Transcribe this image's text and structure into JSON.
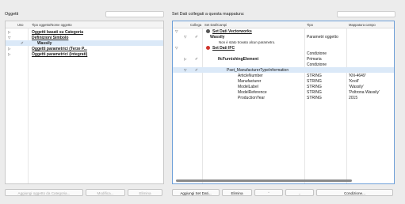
{
  "left": {
    "title": "Oggetti",
    "columns": {
      "use": "Uso",
      "type": "Tipo oggetto/Nome oggetto"
    },
    "rows": [
      {
        "tri": "▷",
        "label": "Oggetti basati su Categoria"
      },
      {
        "tri": "▽",
        "label": "Definizioni Simbolo"
      },
      {
        "pen": "✐",
        "label": "Wassily"
      },
      {
        "tri": "▷",
        "label": "Oggetti parametrici (Terze P..."
      },
      {
        "tri": "▷",
        "label": "Oggetti parametrici (integrati)"
      }
    ],
    "buttons": {
      "add_category": "Aggiungi oggetto da Categoria...",
      "modify": "Modifica...",
      "delete": "Elimina"
    }
  },
  "right": {
    "title": "Set Dati collegati a questa mappatura:",
    "columns": {
      "linked": "Collega",
      "set": "Set Dati/Campi",
      "type": "Tipo",
      "map": "Mappatura campo"
    },
    "rows": [
      {
        "tri": "▽",
        "label": "Set Dati Vectorworks",
        "icon": "vw"
      },
      {
        "tri": "▽",
        "pen": "✐",
        "label": "Wassily",
        "type": "Parametri oggetto"
      },
      {
        "label": "Non è stato trovato alcun parametro."
      },
      {
        "tri": "▽",
        "label": "Set Dati IFC",
        "icon": "ifc"
      },
      {
        "type": "Condizione"
      },
      {
        "tri": "▷",
        "pen": "✐",
        "label": "IfcFurnishingElement",
        "type": "Primaria"
      },
      {
        "type": "Condizione"
      },
      {
        "tri": "▽",
        "pen": "✐",
        "label": "Pset_ManufacturerTypeInformation"
      },
      {
        "label": "ArticleNumber",
        "type": "STRING",
        "map": "'KN-4649'"
      },
      {
        "label": "Manufacturer",
        "type": "STRING",
        "map": "'Knoll'"
      },
      {
        "label": "ModelLabel",
        "type": "STRING",
        "map": "'Wassily'"
      },
      {
        "label": "ModelReference",
        "type": "STRING",
        "map": "'Poltrona Wassily'"
      },
      {
        "label": "ProductionYear",
        "type": "STRING",
        "map": "2015"
      }
    ],
    "buttons": {
      "add": "Aggiungi Set Dati...",
      "delete": "Elimina",
      "up": "⌃",
      "down": "⌄",
      "condition": "Condizione..."
    }
  },
  "colors": {
    "selection": "#dbe9f8",
    "focus": "#6d9fd8",
    "ifc": "#d0342c"
  }
}
